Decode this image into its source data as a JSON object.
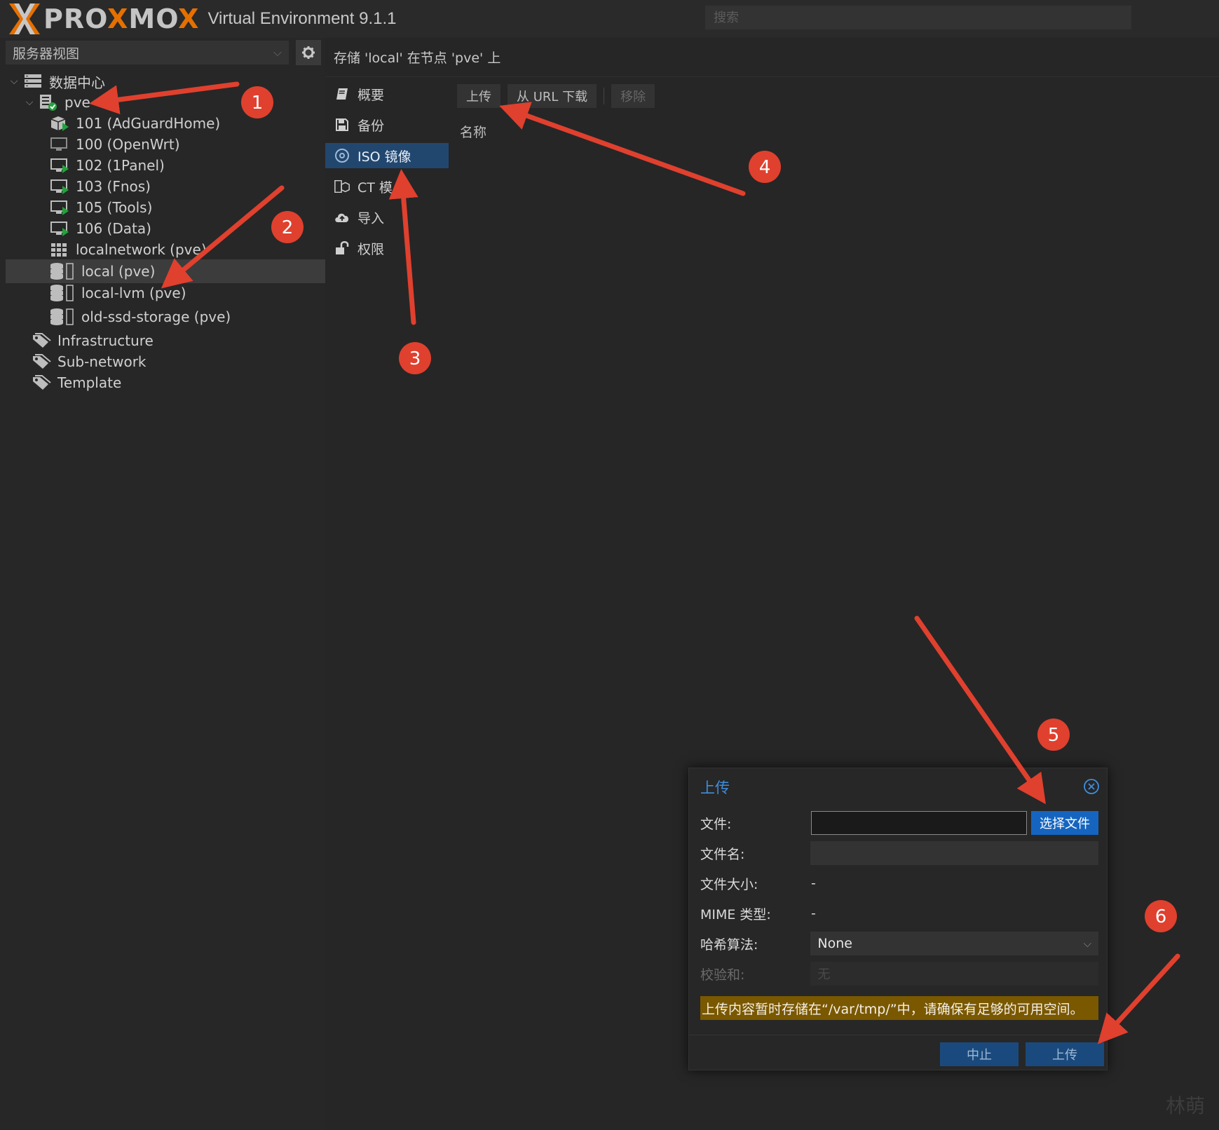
{
  "topbar": {
    "brand_left": "PRO",
    "brand_x": "X",
    "brand_mid": "MO",
    "brand_x2": "X",
    "version": "Virtual Environment 9.1.1",
    "search_placeholder": "搜索"
  },
  "sidebar": {
    "view_label": "服务器视图",
    "tree": [
      {
        "label": "数据中心",
        "icon": "datacenter-icon"
      },
      {
        "label": "pve",
        "icon": "node-online-icon"
      },
      {
        "label": "101 (AdGuardHome)",
        "icon": "container-running-icon"
      },
      {
        "label": "100 (OpenWrt)",
        "icon": "vm-stopped-icon"
      },
      {
        "label": "102 (1Panel)",
        "icon": "vm-running-icon"
      },
      {
        "label": "103 (Fnos)",
        "icon": "vm-running-icon"
      },
      {
        "label": "105 (Tools)",
        "icon": "vm-running-icon"
      },
      {
        "label": "106 (Data)",
        "icon": "vm-running-icon"
      },
      {
        "label": "localnetwork (pve)",
        "icon": "network-grid-icon"
      },
      {
        "label": "local (pve)",
        "icon": "storage-icon"
      },
      {
        "label": "local-lvm (pve)",
        "icon": "storage-icon"
      },
      {
        "label": "old-ssd-storage (pve)",
        "icon": "storage-icon"
      },
      {
        "label": "Infrastructure",
        "icon": "tag-icon"
      },
      {
        "label": "Sub-network",
        "icon": "tag-icon"
      },
      {
        "label": "Template",
        "icon": "tag-icon"
      }
    ]
  },
  "content": {
    "header_title": "存储 'local' 在节点 'pve' 上",
    "nav": [
      {
        "label": "概要",
        "icon": "book-icon"
      },
      {
        "label": "备份",
        "icon": "floppy-icon"
      },
      {
        "label": "ISO 镜像",
        "icon": "disc-icon"
      },
      {
        "label": "CT 模",
        "icon": "template-icon"
      },
      {
        "label": "导入",
        "icon": "cloud-upload-icon"
      },
      {
        "label": "权限",
        "icon": "unlock-icon"
      }
    ],
    "toolbar": {
      "upload": "上传",
      "download_url": "从 URL 下载",
      "remove": "移除"
    },
    "column_name": "名称"
  },
  "dialog": {
    "title": "上传",
    "file_label": "文件:",
    "choose_file": "选择文件",
    "filename_label": "文件名:",
    "filesize_label": "文件大小:",
    "filesize_value": "-",
    "mime_label": "MIME 类型:",
    "mime_value": "-",
    "hash_label": "哈希算法:",
    "hash_value": "None",
    "checksum_label": "校验和:",
    "checksum_placeholder": "无",
    "warning": "上传内容暂时存储在“/var/tmp/”中，请确保有足够的可用空间。",
    "abort": "中止",
    "upload": "上传"
  },
  "annotations": {
    "badges": [
      "1",
      "2",
      "3",
      "4",
      "5",
      "6"
    ],
    "color": "#e0402e"
  },
  "watermark": "林萌"
}
